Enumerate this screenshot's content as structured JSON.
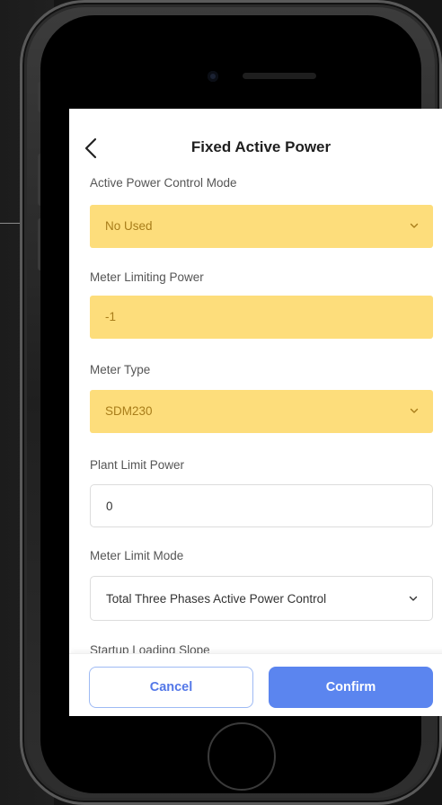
{
  "header": {
    "title": "Fixed Active Power"
  },
  "form": {
    "active_power_control_mode": {
      "label": "Active Power Control Mode",
      "value": "No Used"
    },
    "meter_limiting_power": {
      "label": "Meter Limiting Power",
      "value": "-1"
    },
    "meter_type": {
      "label": "Meter Type",
      "value": "SDM230"
    },
    "plant_limit_power": {
      "label": "Plant Limit Power",
      "value": "0"
    },
    "meter_limit_mode": {
      "label": "Meter Limit Mode",
      "value": "Total Three Phases Active Power Control"
    },
    "startup_loading_slope": {
      "label": "Startup Loading Slope"
    }
  },
  "footer": {
    "cancel_label": "Cancel",
    "confirm_label": "Confirm"
  },
  "colors": {
    "highlight": "#fddd7b",
    "primary": "#5b85ef",
    "background": "#151515"
  },
  "icons": {
    "back": "chevron-left-icon",
    "dropdown": "chevron-down-icon"
  }
}
